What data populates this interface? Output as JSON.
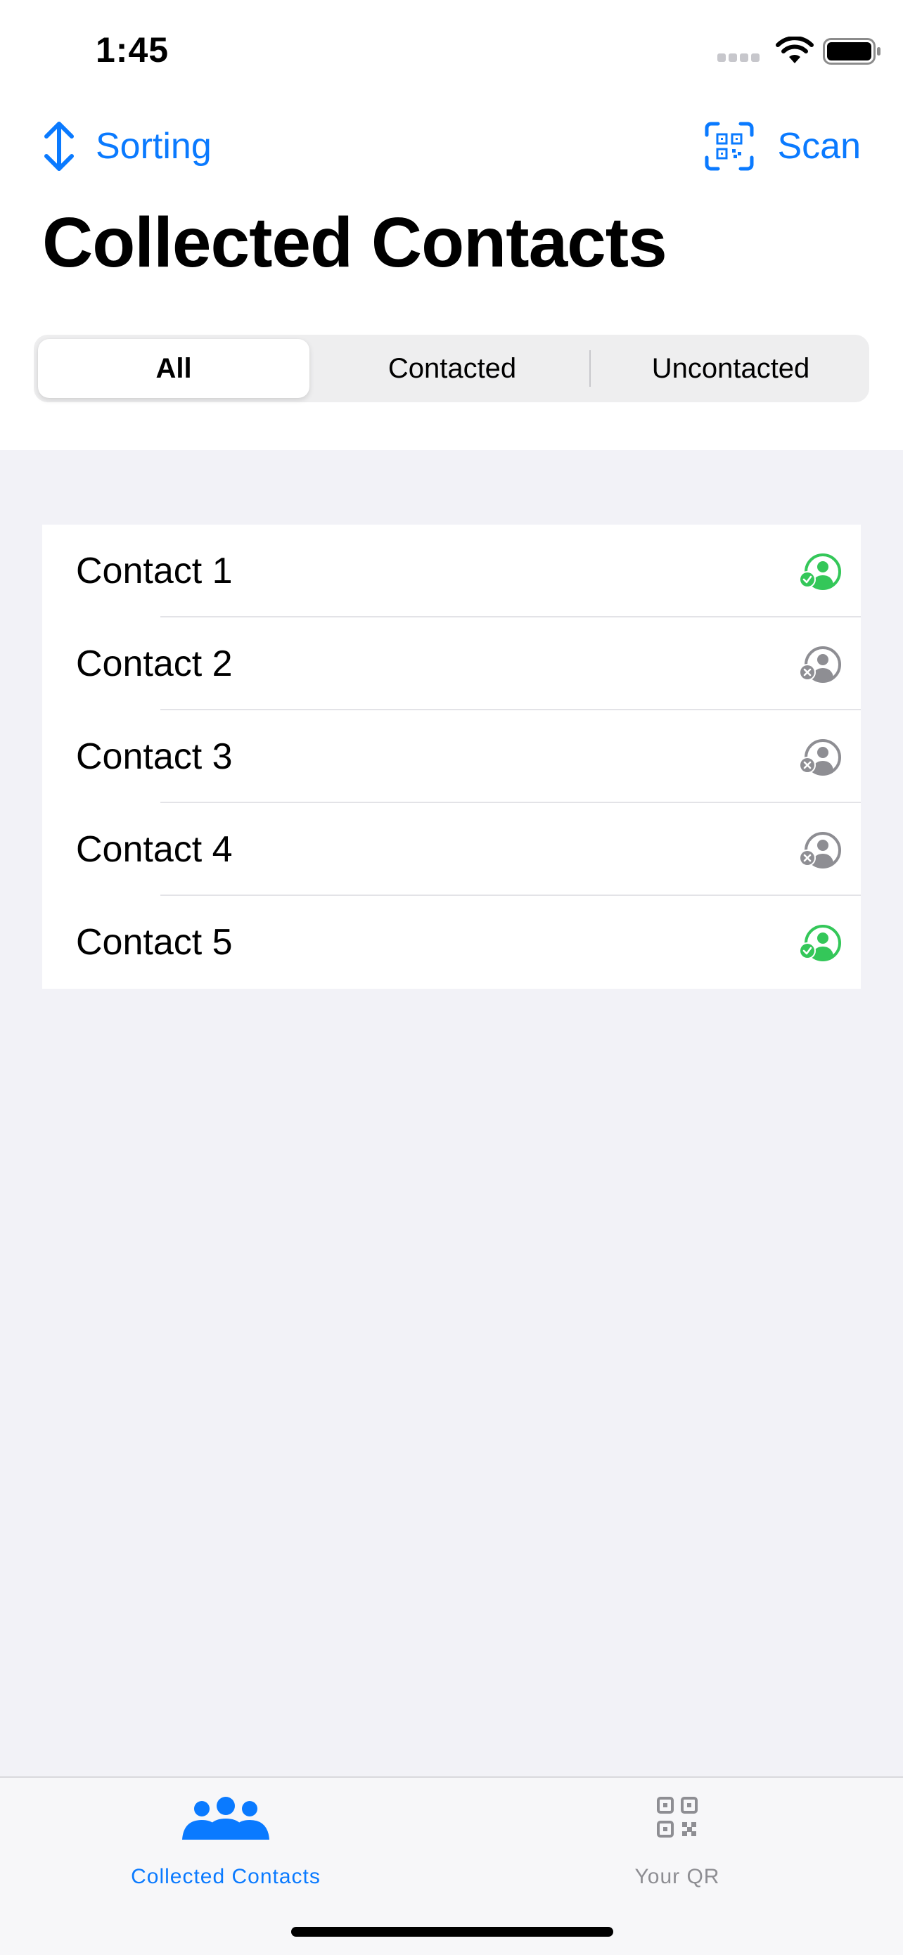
{
  "status_bar": {
    "time": "1:45"
  },
  "nav": {
    "left_label": "Sorting",
    "right_label": "Scan"
  },
  "title": "Collected Contacts",
  "segments": [
    {
      "label": "All",
      "active": true
    },
    {
      "label": "Contacted",
      "active": false
    },
    {
      "label": "Uncontacted",
      "active": false
    }
  ],
  "contacts": [
    {
      "name": "Contact 1",
      "status": "contacted"
    },
    {
      "name": "Contact 2",
      "status": "uncontacted"
    },
    {
      "name": "Contact 3",
      "status": "uncontacted"
    },
    {
      "name": "Contact 4",
      "status": "uncontacted"
    },
    {
      "name": "Contact 5",
      "status": "contacted"
    }
  ],
  "tabs": [
    {
      "label": "Collected Contacts",
      "icon": "people-icon",
      "active": true
    },
    {
      "label": "Your QR",
      "icon": "qr-code-icon",
      "active": false
    }
  ],
  "colors": {
    "accent": "#0a7aff",
    "contacted": "#34c759",
    "uncontacted": "#8e8e93",
    "inactive_tab": "#8e8e93"
  }
}
